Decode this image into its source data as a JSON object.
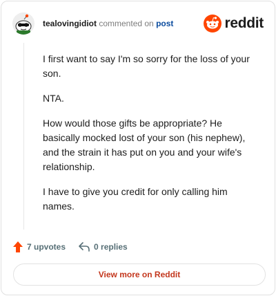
{
  "header": {
    "username": "tealovingidiot",
    "action_text": "commented on",
    "post_link": "post",
    "brand": "reddit"
  },
  "comment": {
    "paragraphs": [
      "I first want to say I'm so sorry for the loss of your son.",
      "NTA.",
      "How would those gifts be appropriate? He basically mocked lost of your son (his nephew), and the strain it has put on you and your wife's relationship.",
      "I have to give you credit for only calling him names."
    ]
  },
  "actions": {
    "upvotes": "7 upvotes",
    "replies": "0 replies"
  },
  "footer": {
    "view_button": "View more on Reddit"
  },
  "colors": {
    "brand_orange": "#ff4500",
    "upvote": "#ff4500",
    "link_blue": "#0a4b9e",
    "cta_red": "#c3361c"
  },
  "icons": [
    "snoo-avatar-icon",
    "reddit-logo-icon",
    "upvote-arrow-icon",
    "reply-arrow-icon"
  ]
}
